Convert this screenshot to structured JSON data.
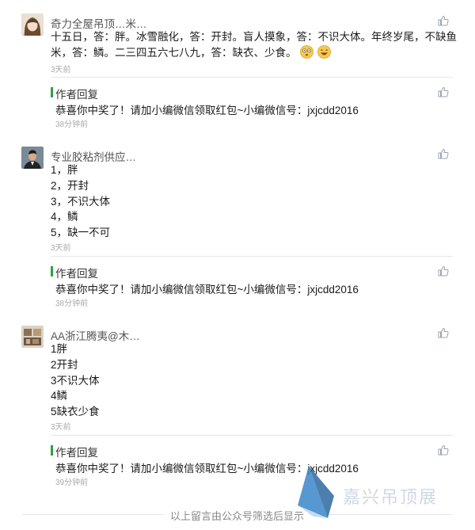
{
  "comments": [
    {
      "nickname": "奇力全屋吊顶…米…",
      "lines": [
        "十五日，答：胖。冰雪融化，答：开封。盲人摸象，答：不识大体。年终岁尾，不缺鱼",
        "米，答：鳞。二三四五六七八九，答：缺衣、少食。"
      ],
      "emojis": [
        "dizzy-face-emoji",
        "grinning-face-emoji"
      ],
      "time": "3天前",
      "reply": {
        "label": "作者回复",
        "text": "恭喜你中奖了！请加小编微信领取红包~小编微信号：jxjcdd2016",
        "time": "38分钟前"
      }
    },
    {
      "nickname": "专业胶粘剂供应…",
      "lines": [
        "1，胖",
        "2，开封",
        "3，不识大体",
        "4，鳞",
        "5，缺一不可"
      ],
      "time": "3天前",
      "reply": {
        "label": "作者回复",
        "text": "恭喜你中奖了！请加小编微信领取红包~小编微信号：jxjcdd2016",
        "time": "38分钟前"
      }
    },
    {
      "nickname": "AA浙江腾夷@木…",
      "lines": [
        "1胖",
        "2开封",
        "3不识大体",
        "4鳞",
        "5缺衣少食"
      ],
      "time": "3天前",
      "reply": {
        "label": "作者回复",
        "text": "恭喜你中奖了！请加小编微信领取红包~小编微信号：jxjcdd2016",
        "time": "39分钟前"
      }
    }
  ],
  "footer": {
    "text": "以上留言由公众号筛选后显示"
  },
  "watermark": {
    "text": "嘉兴吊顶展"
  },
  "icons": {
    "like": "thumbs-up-icon",
    "logo": "triangle-logo-icon"
  },
  "colors": {
    "reply_bar": "#2ba245",
    "nickname": "#555555",
    "time": "#aaaaaa",
    "like_icon": "#9aa4b0"
  }
}
